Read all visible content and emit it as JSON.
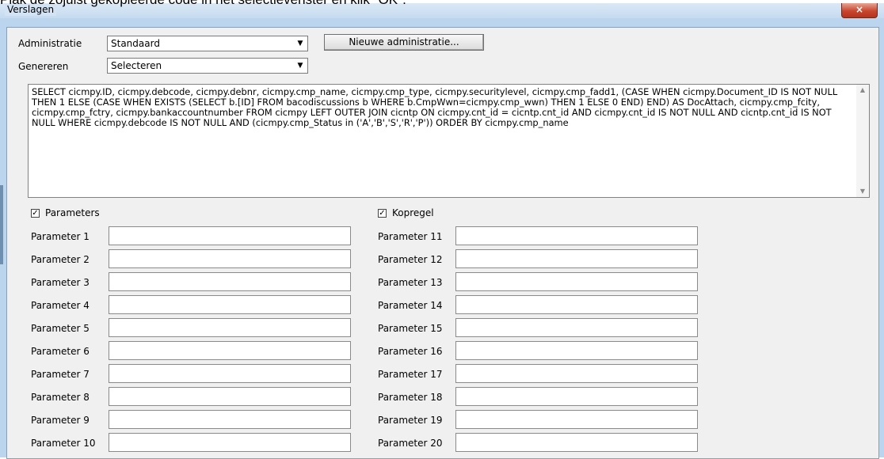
{
  "caption": "Plak de zojuist gekopieerde code in het selectievenster en klik \"OK\".",
  "window": {
    "title": "Verslagen",
    "close_icon": "×"
  },
  "administratie": {
    "label": "Administratie",
    "value": "Standaard"
  },
  "genereren": {
    "label": "Genereren",
    "value": "Selecteren"
  },
  "new_admin_button": "Nieuwe administratie...",
  "sql_text": "SELECT cicmpy.ID, cicmpy.debcode, cicmpy.debnr, cicmpy.cmp_name, cicmpy.cmp_type, cicmpy.securitylevel, cicmpy.cmp_fadd1, (CASE WHEN cicmpy.Document_ID IS NOT NULL THEN 1 ELSE (CASE WHEN EXISTS (SELECT b.[ID] FROM bacodiscussions b WHERE b.CmpWwn=cicmpy.cmp_wwn) THEN 1 ELSE 0 END) END) AS DocAttach, cicmpy.cmp_fcity, cicmpy.cmp_fctry, cicmpy.bankaccountnumber FROM cicmpy  LEFT OUTER JOIN cicntp ON cicmpy.cnt_id = cicntp.cnt_id AND cicmpy.cnt_id IS NOT NULL AND cicntp.cnt_id IS NOT NULL WHERE cicmpy.debcode IS NOT NULL AND (cicmpy.cmp_Status in ('A','B','S','R','P')) ORDER BY cicmpy.cmp_name",
  "parameters_checkbox": {
    "label": "Parameters",
    "checked": true
  },
  "kopregel_checkbox": {
    "label": "Kopregel",
    "checked": true
  },
  "params_left": [
    {
      "label": "Parameter 1",
      "value": ""
    },
    {
      "label": "Parameter 2",
      "value": ""
    },
    {
      "label": "Parameter 3",
      "value": ""
    },
    {
      "label": "Parameter 4",
      "value": ""
    },
    {
      "label": "Parameter 5",
      "value": ""
    },
    {
      "label": "Parameter 6",
      "value": ""
    },
    {
      "label": "Parameter 7",
      "value": ""
    },
    {
      "label": "Parameter 8",
      "value": ""
    },
    {
      "label": "Parameter 9",
      "value": ""
    },
    {
      "label": "Parameter 10",
      "value": ""
    }
  ],
  "params_right": [
    {
      "label": "Parameter 11",
      "value": ""
    },
    {
      "label": "Parameter 12",
      "value": ""
    },
    {
      "label": "Parameter 13",
      "value": ""
    },
    {
      "label": "Parameter 14",
      "value": ""
    },
    {
      "label": "Parameter 15",
      "value": ""
    },
    {
      "label": "Parameter 16",
      "value": ""
    },
    {
      "label": "Parameter 17",
      "value": ""
    },
    {
      "label": "Parameter 18",
      "value": ""
    },
    {
      "label": "Parameter 19",
      "value": ""
    },
    {
      "label": "Parameter 20",
      "value": ""
    }
  ]
}
